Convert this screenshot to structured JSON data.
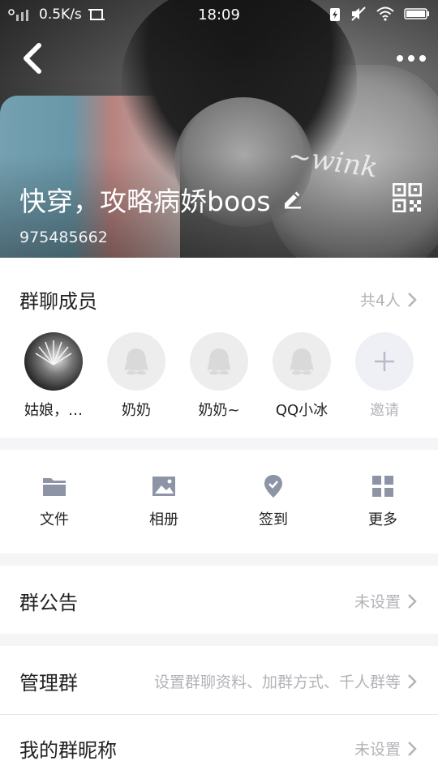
{
  "status_bar": {
    "net_speed": "0.5K/s",
    "time": "18:09"
  },
  "header": {
    "group_name": "快穿，攻略病娇boos",
    "group_id": "975485662",
    "wink_text": "~wink"
  },
  "members": {
    "title": "群聊成员",
    "count": "共4人",
    "list": [
      {
        "name": "姑娘，…"
      },
      {
        "name": "奶奶"
      },
      {
        "name": "奶奶~"
      },
      {
        "name": "QQ小冰"
      }
    ],
    "invite": "邀请"
  },
  "tools": [
    {
      "label": "文件",
      "icon": "folder-icon"
    },
    {
      "label": "相册",
      "icon": "image-icon"
    },
    {
      "label": "签到",
      "icon": "checkin-icon"
    },
    {
      "label": "更多",
      "icon": "grid-icon"
    }
  ],
  "announcement": {
    "title": "群公告",
    "value": "未设置"
  },
  "manage": {
    "title": "管理群",
    "value": "设置群聊资料、加群方式、千人群等"
  },
  "nickname": {
    "title": "我的群昵称",
    "value": "未设置"
  },
  "colors": {
    "accent": "#5b86c5",
    "muted": "#b3b3b8",
    "icon_gray": "#8c94a6"
  }
}
